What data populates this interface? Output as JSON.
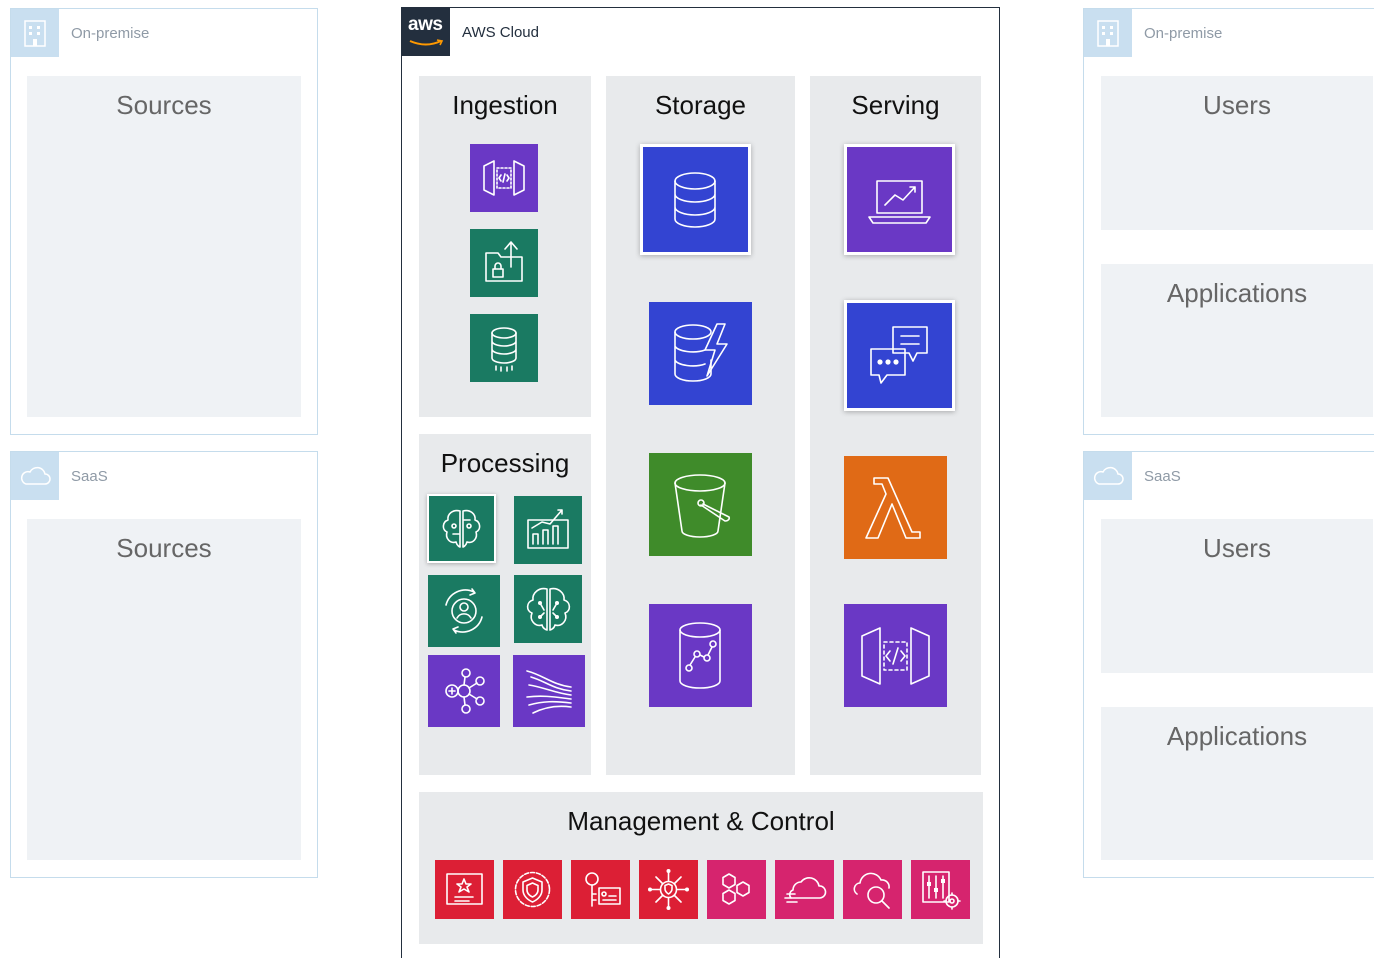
{
  "left": {
    "onprem": {
      "label": "On-premise",
      "inner": "Sources"
    },
    "saas": {
      "label": "SaaS",
      "inner": "Sources"
    }
  },
  "right": {
    "onprem": {
      "label": "On-premise",
      "users": "Users",
      "apps": "Applications"
    },
    "saas": {
      "label": "SaaS",
      "users": "Users",
      "apps": "Applications"
    }
  },
  "cloud": {
    "logo": "aws",
    "label": "AWS Cloud",
    "ingestion": "Ingestion",
    "processing": "Processing",
    "storage": "Storage",
    "serving": "Serving",
    "management": "Management & Control"
  },
  "icons": {
    "ingestion": [
      "api-gateway-icon",
      "transfer-family-icon",
      "database-migration-icon"
    ],
    "processing": [
      "sagemaker-icon",
      "quicksight-icon",
      "personalize-icon",
      "comprehend-icon",
      "glue-icon",
      "kinesis-icon"
    ],
    "storage": [
      "rds-database-icon",
      "dynamodb-icon",
      "s3-bucket-icon",
      "redshift-icon"
    ],
    "serving": [
      "quicksight-laptop-icon",
      "chat-icon",
      "lambda-icon",
      "api-endpoint-icon"
    ],
    "management": [
      "certificate-icon",
      "shield-icon",
      "secrets-key-icon",
      "network-security-icon",
      "cloudformation-icon",
      "cloud-services-icon",
      "cloudwatch-search-icon",
      "systems-manager-icon"
    ]
  },
  "colors": {
    "purple": "#6a38c5",
    "teal": "#1a7a62",
    "blue": "#3344d2",
    "green": "#3f8b2a",
    "orange": "#e06a16",
    "red": "#dc1f35",
    "pink": "#d6246e",
    "aws_dark": "#232f3e",
    "group_border": "#c5dcec"
  }
}
